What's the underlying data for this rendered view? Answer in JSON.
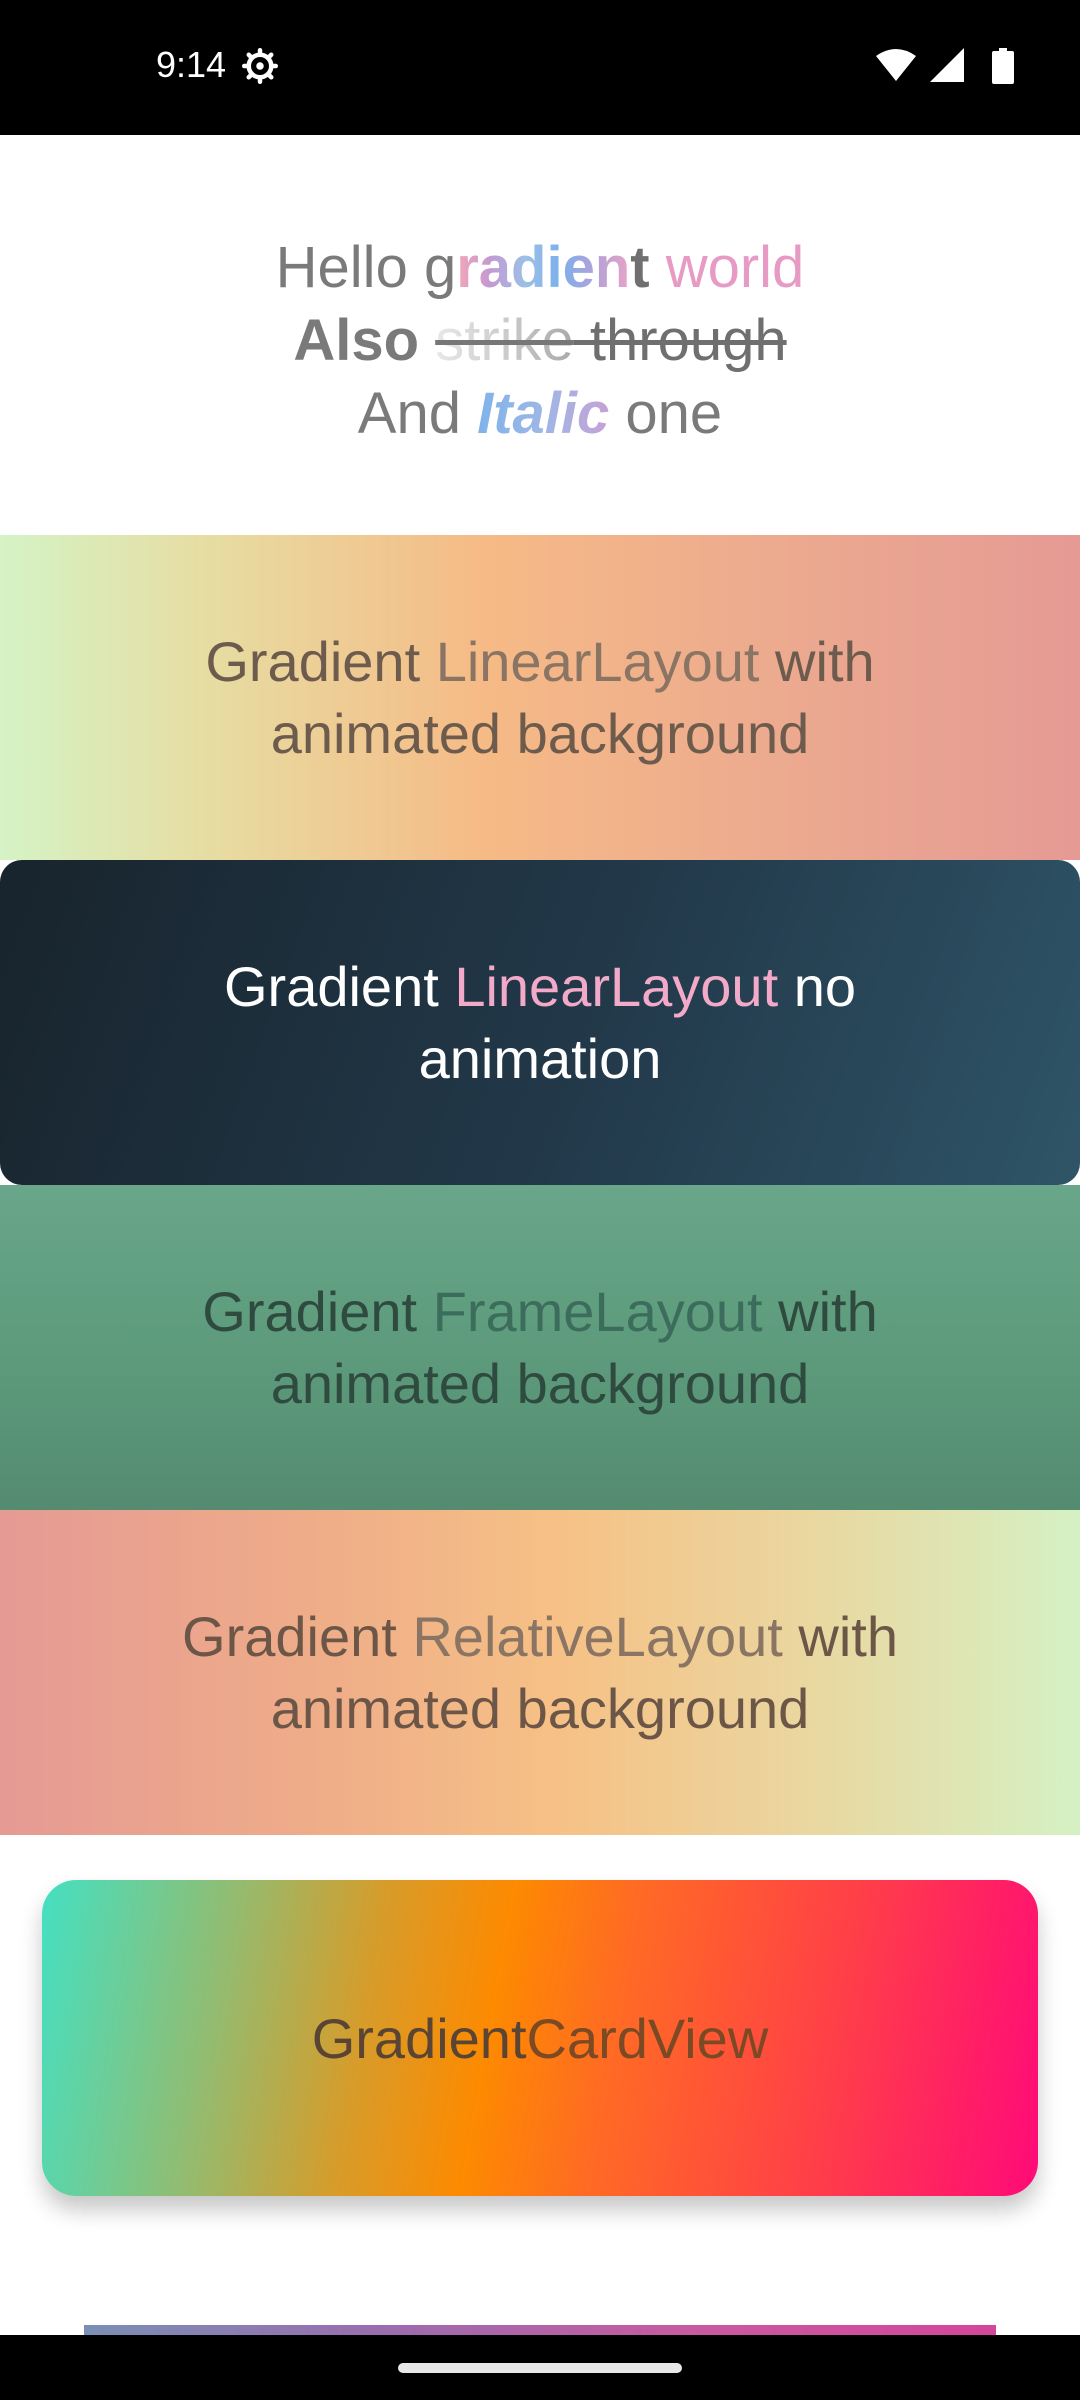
{
  "status_bar": {
    "time": "9:14",
    "icons": [
      "settings-gear-icon",
      "wifi-icon",
      "cellular-signal-icon",
      "battery-icon"
    ]
  },
  "hero": {
    "line1": {
      "plain1": "Hello g",
      "grad": "radien",
      "bold_t": "t",
      "space": " ",
      "world": "world"
    },
    "line2": {
      "bold": "Also",
      "space": " ",
      "fade": "strike",
      "strike": " through"
    },
    "line3": {
      "plain1": "And ",
      "italic": "Italic",
      "plain2": " one"
    }
  },
  "panels": [
    {
      "prefix": "Gradient ",
      "highlight": "LinearLayout",
      "suffix": " with animated background"
    },
    {
      "prefix": "Gradient ",
      "highlight": "LinearLayout",
      "suffix": " no animation"
    },
    {
      "prefix": "Gradient ",
      "highlight": "FrameLayout",
      "suffix": " with animated background"
    },
    {
      "prefix": "Gradient ",
      "highlight": "RelativeLayout",
      "suffix": " with animated background"
    }
  ],
  "card": {
    "prefix": "Gradient ",
    "highlight": "CardView"
  },
  "colors": {
    "card_gradient": [
      "#44e0c2",
      "#fd8a00",
      "#ff0a78"
    ],
    "panel2_highlight": "#f3aac9"
  }
}
